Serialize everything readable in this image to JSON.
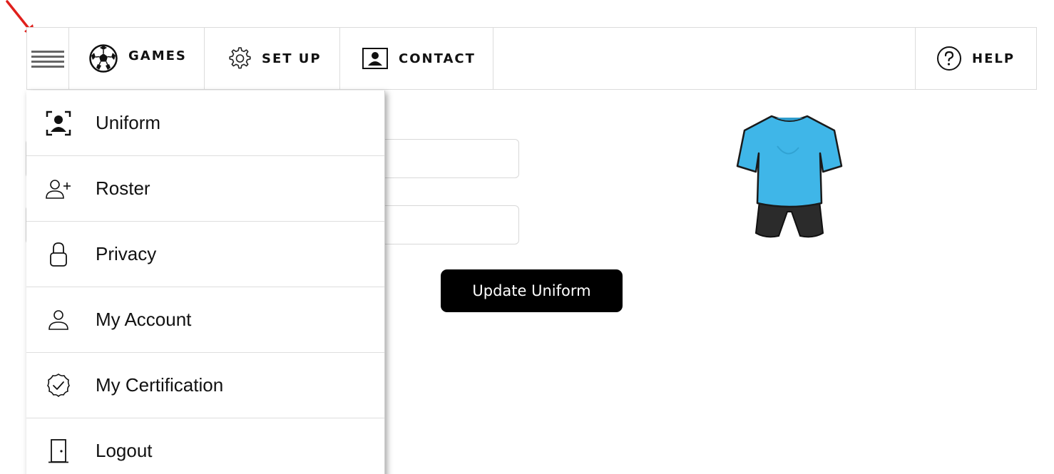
{
  "nav": {
    "menu_icon": "hamburger-icon",
    "items": [
      {
        "label": "GAMES",
        "icon": "soccer-ball-icon"
      },
      {
        "label": "SET UP",
        "icon": "gear-icon"
      },
      {
        "label": "CONTACT",
        "icon": "contact-card-icon"
      }
    ],
    "help": {
      "label": "HELP",
      "icon": "question-circle-icon"
    }
  },
  "drawer": {
    "items": [
      {
        "label": "Uniform",
        "icon": "person-frame-icon"
      },
      {
        "label": "Roster",
        "icon": "user-plus-icon"
      },
      {
        "label": "Privacy",
        "icon": "lock-icon"
      },
      {
        "label": "My Account",
        "icon": "user-icon"
      },
      {
        "label": "My Certification",
        "icon": "badge-check-icon"
      },
      {
        "label": "Logout",
        "icon": "door-icon"
      }
    ]
  },
  "form": {
    "field_1_value": "",
    "field_2_value": "",
    "submit_label": "Update Uniform"
  },
  "uniform": {
    "shirt_color": "#3fb6e8",
    "shorts_color": "#2a2a2a"
  },
  "colors": {
    "annotation_arrow": "#e0201c",
    "button_bg": "#000000"
  }
}
